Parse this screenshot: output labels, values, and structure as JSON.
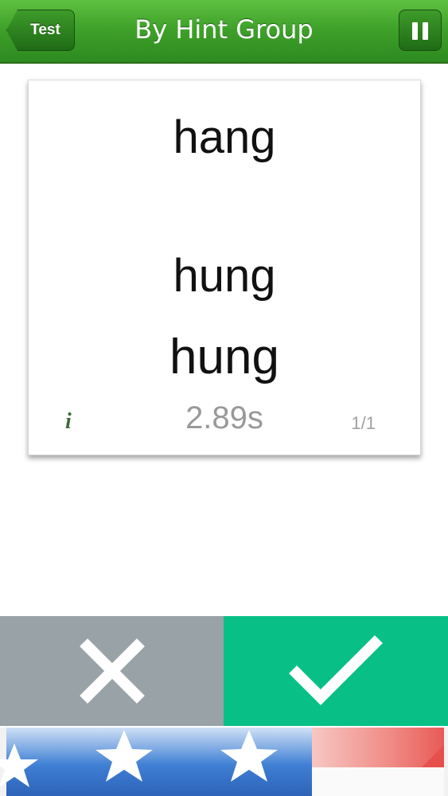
{
  "navbar": {
    "back_label": "Test",
    "title": "By Hint Group",
    "pause_icon": "pause-icon"
  },
  "card": {
    "prompt_word": "hang",
    "answer_word_1": "hung",
    "answer_word_2": "hung",
    "info_glyph": "i",
    "timer": "2.89s",
    "counter": "1/1"
  },
  "actions": {
    "wrong_icon": "close-icon",
    "right_icon": "checkmark-icon"
  },
  "colors": {
    "nav_green": "#3fa22a",
    "wrong_gray": "#98a2a7",
    "right_green": "#08c086"
  }
}
